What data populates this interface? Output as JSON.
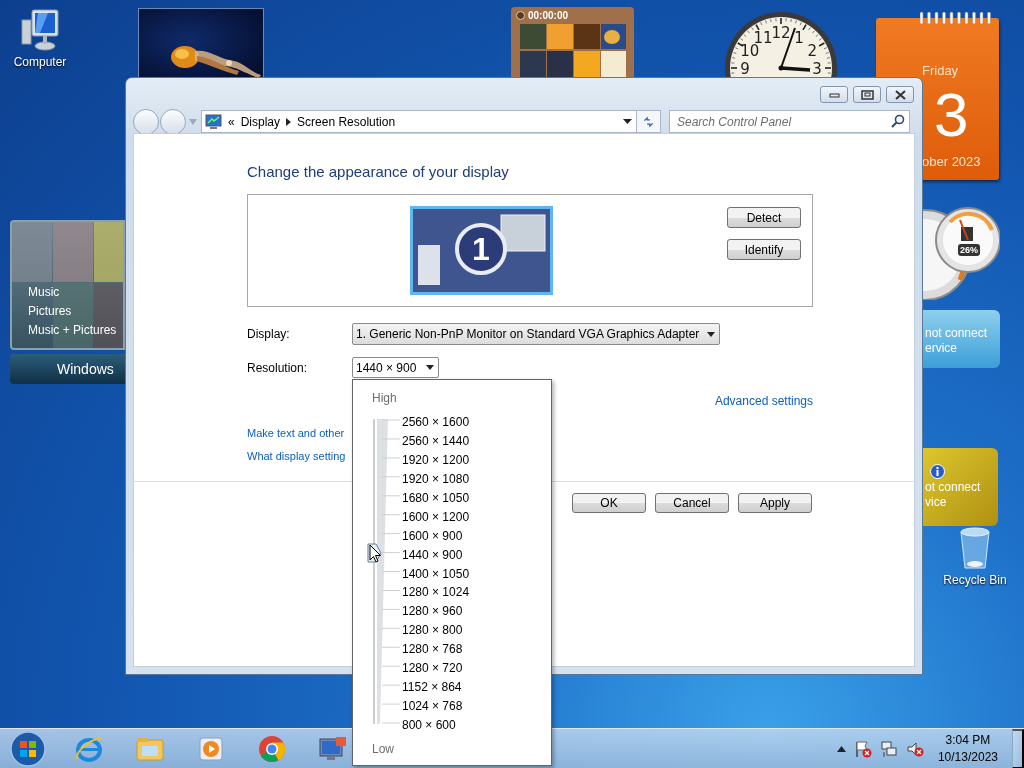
{
  "desktop": {
    "icons": [
      {
        "label": "Computer",
        "kind": "computer"
      },
      {
        "label": "Recycle Bin",
        "kind": "recycle"
      }
    ]
  },
  "gadgets": {
    "puzzle": {
      "timer": "00:00:00"
    },
    "clock": {
      "numerals": [
        "9",
        "10",
        "11",
        "12",
        "1",
        "2",
        "3"
      ]
    },
    "calendar": {
      "weekday": "Friday",
      "day": "3",
      "month": "ober 2023"
    },
    "cpu_meter": {
      "reading": "26%"
    },
    "media_center": {
      "items": [
        "Music",
        "Pictures",
        "Music + Pictures"
      ],
      "title": "Windows"
    },
    "feeds": [
      {
        "kind": "weather",
        "lines": [
          "not connect",
          "ervice"
        ]
      },
      {
        "kind": "currency",
        "lines": [
          "ot connect",
          "vice"
        ]
      }
    ]
  },
  "window": {
    "address": {
      "chevron": "«",
      "crumbs": [
        "Display",
        "Screen Resolution"
      ]
    },
    "search": {
      "placeholder": "Search Control Panel"
    },
    "heading": "Change the appearance of your display",
    "monitors": [
      {
        "number": "1",
        "selected": true
      }
    ],
    "side_buttons": [
      "Detect",
      "Identify"
    ],
    "fields": [
      {
        "label": "Display:",
        "value": "1. Generic Non-PnP Monitor on Standard VGA Graphics Adapter",
        "expanded": false
      },
      {
        "label": "Resolution:",
        "value": "1440 × 900",
        "expanded": true
      }
    ],
    "advanced_link": "Advanced settings",
    "links": [
      "Make text and other",
      "What display setting"
    ],
    "buttons": [
      "OK",
      "Cancel",
      "Apply"
    ]
  },
  "resolution_menu": {
    "top_label": "High",
    "bottom_label": "Low",
    "options": [
      {
        "label": "2560 × 1600",
        "selected": false
      },
      {
        "label": "2560 × 1440",
        "selected": false
      },
      {
        "label": "1920 × 1200",
        "selected": false
      },
      {
        "label": "1920 × 1080",
        "selected": false
      },
      {
        "label": "1680 × 1050",
        "selected": false
      },
      {
        "label": "1600 × 1200",
        "selected": false
      },
      {
        "label": "1600 × 900",
        "selected": false
      },
      {
        "label": "1440 × 900",
        "selected": true
      },
      {
        "label": "1400 × 1050",
        "selected": false
      },
      {
        "label": "1280 × 1024",
        "selected": false
      },
      {
        "label": "1280 × 960",
        "selected": false
      },
      {
        "label": "1280 × 800",
        "selected": false
      },
      {
        "label": "1280 × 768",
        "selected": false
      },
      {
        "label": "1280 × 720",
        "selected": false
      },
      {
        "label": "1152 × 864",
        "selected": false
      },
      {
        "label": "1024 × 768",
        "selected": false
      },
      {
        "label": "800 × 600",
        "selected": false
      }
    ]
  },
  "taskbar": {
    "pinned": [
      {
        "kind": "browser"
      },
      {
        "kind": "folder"
      },
      {
        "kind": "media"
      },
      {
        "kind": "chrome"
      },
      {
        "kind": "remote"
      }
    ],
    "tray": {
      "time": "3:04 PM",
      "date": "10/13/2023"
    }
  }
}
